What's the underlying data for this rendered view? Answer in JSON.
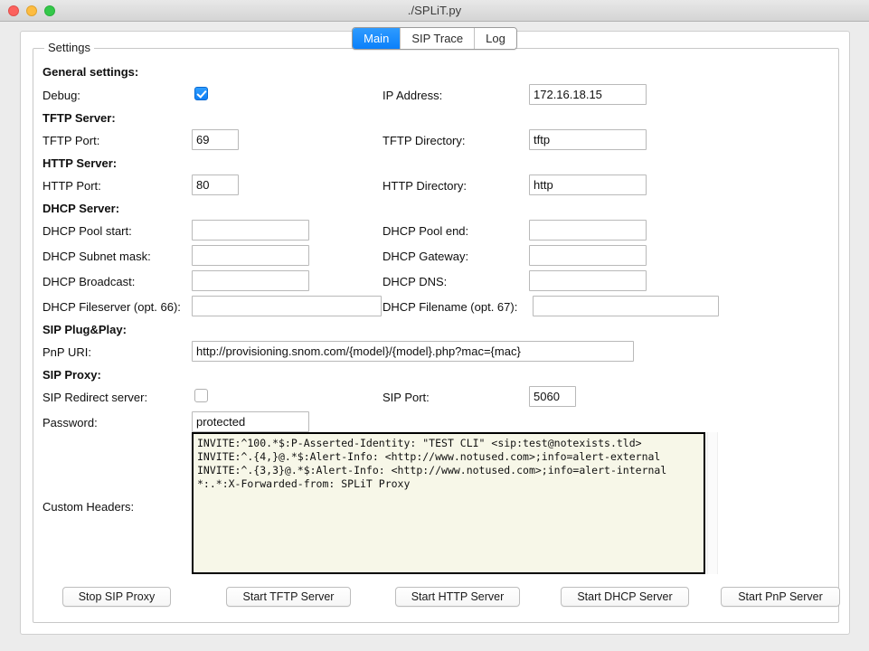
{
  "window": {
    "title": "./SPLiT.py",
    "controls": [
      "close",
      "minimize",
      "zoom"
    ]
  },
  "tabs": [
    {
      "label": "Main",
      "active": true
    },
    {
      "label": "SIP Trace",
      "active": false
    },
    {
      "label": "Log",
      "active": false
    }
  ],
  "group": {
    "title": "Settings"
  },
  "sections": {
    "general": "General settings:",
    "tftp": "TFTP Server:",
    "http": "HTTP Server:",
    "dhcp": "DHCP Server:",
    "pnp": "SIP Plug&Play:",
    "sip_proxy": "SIP Proxy:"
  },
  "fields": {
    "debug": {
      "label": "Debug:",
      "checked": true
    },
    "ip_address": {
      "label": "IP Address:",
      "value": "172.16.18.15"
    },
    "tftp_port": {
      "label": "TFTP Port:",
      "value": "69"
    },
    "tftp_directory": {
      "label": "TFTP Directory:",
      "value": "tftp"
    },
    "http_port": {
      "label": "HTTP Port:",
      "value": "80"
    },
    "http_directory": {
      "label": "HTTP Directory:",
      "value": "http"
    },
    "dhcp_pool_start": {
      "label": "DHCP Pool start:",
      "value": ""
    },
    "dhcp_pool_end": {
      "label": "DHCP Pool end:",
      "value": ""
    },
    "dhcp_subnet_mask": {
      "label": "DHCP Subnet mask:",
      "value": ""
    },
    "dhcp_gateway": {
      "label": "DHCP Gateway:",
      "value": ""
    },
    "dhcp_broadcast": {
      "label": "DHCP Broadcast:",
      "value": ""
    },
    "dhcp_dns": {
      "label": "DHCP DNS:",
      "value": ""
    },
    "dhcp_fileserver": {
      "label": "DHCP Fileserver (opt. 66):",
      "value": ""
    },
    "dhcp_filename": {
      "label": "DHCP Filename (opt. 67):",
      "value": ""
    },
    "pnp_uri": {
      "label": "PnP URI:",
      "value": "http://provisioning.snom.com/{model}/{model}.php?mac={mac}"
    },
    "sip_redirect": {
      "label": "SIP Redirect server:",
      "checked": false
    },
    "sip_port": {
      "label": "SIP Port:",
      "value": "5060"
    },
    "password": {
      "label": "Password:",
      "value": "protected"
    },
    "custom_headers": {
      "label": "Custom Headers:",
      "value": "INVITE:^100.*$:P-Asserted-Identity: \"TEST CLI\" <sip:test@notexists.tld>\nINVITE:^.{4,}@.*$:Alert-Info: <http://www.notused.com>;info=alert-external\nINVITE:^.{3,3}@.*$:Alert-Info: <http://www.notused.com>;info=alert-internal\n*:.*:X-Forwarded-from: SPLiT Proxy"
    }
  },
  "buttons": {
    "sip_proxy": "Stop SIP Proxy",
    "tftp_server": "Start TFTP Server",
    "http_server": "Start HTTP Server",
    "dhcp_server": "Start DHCP Server",
    "pnp_server": "Start PnP Server"
  },
  "colors": {
    "accent": "#0b80fa",
    "checkbox_on": "#2f9dff",
    "textarea_bg": "#f7f7e8",
    "window_bg": "#ececec"
  }
}
